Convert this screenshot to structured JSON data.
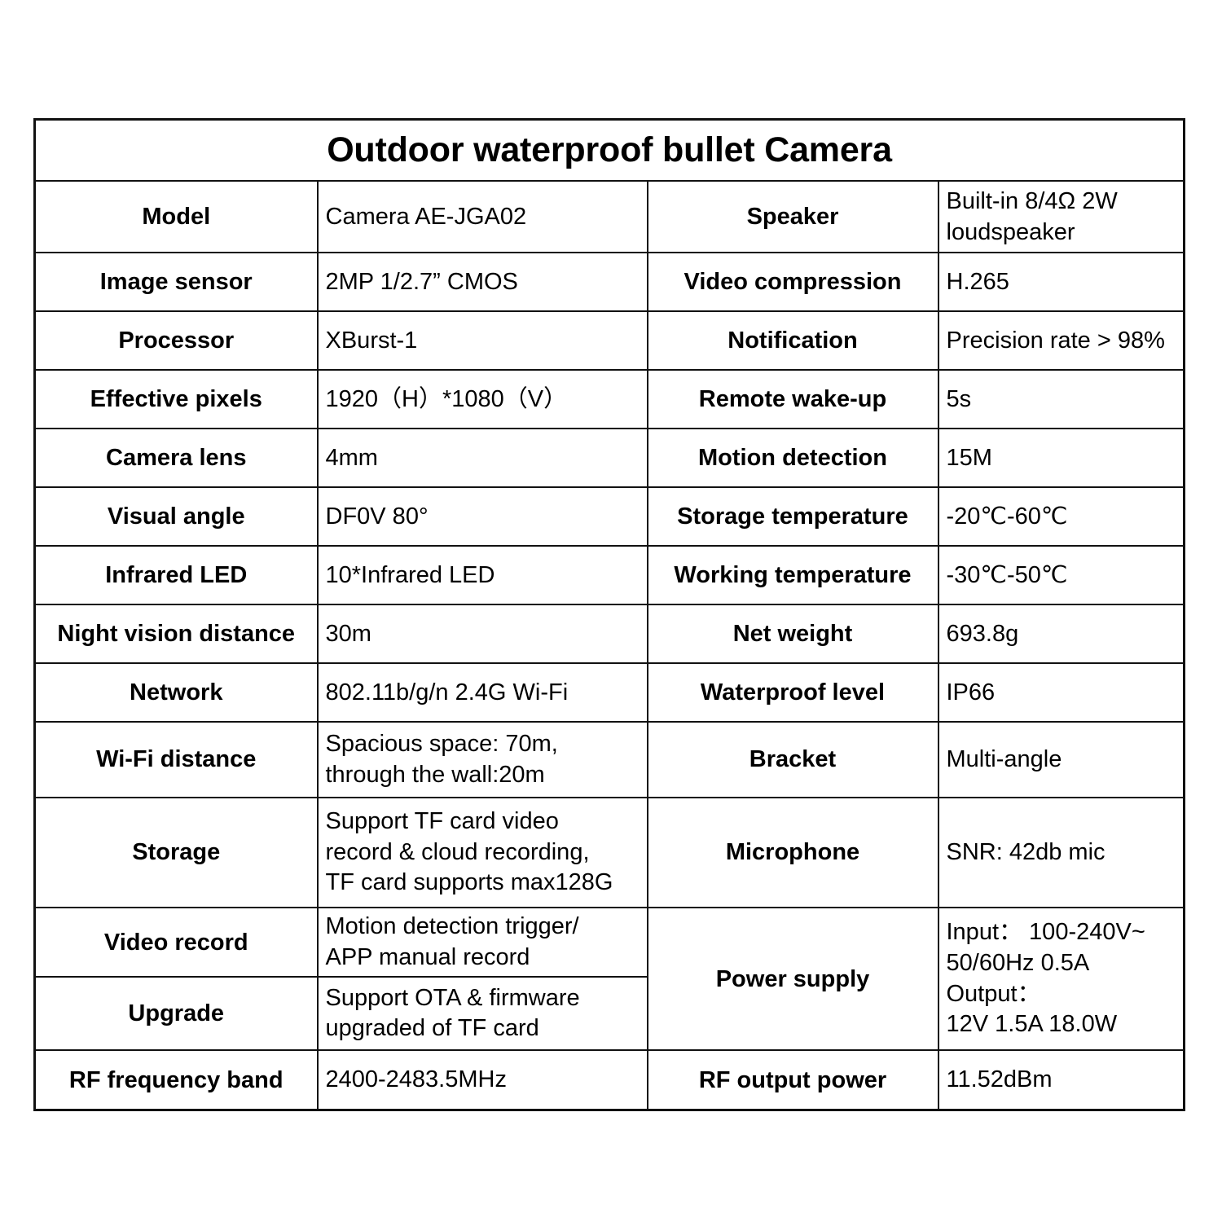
{
  "document": {
    "title": "Outdoor waterproof bullet Camera"
  },
  "rows": [
    {
      "left_label": "Model",
      "left_value": [
        "Camera AE-JGA02"
      ],
      "right_label": "Speaker",
      "right_value": [
        "Built-in 8/4Ω 2W",
        "loudspeaker"
      ]
    },
    {
      "left_label": "Image sensor",
      "left_value": [
        "2MP 1/2.7” CMOS"
      ],
      "right_label": "Video compression",
      "right_value": [
        "H.265"
      ]
    },
    {
      "left_label": "Processor",
      "left_value": [
        "XBurst-1"
      ],
      "right_label": "Notification",
      "right_value": [
        "Precision rate > 98%"
      ]
    },
    {
      "left_label": "Effective pixels",
      "left_value": [
        "1920（H）*1080（V）"
      ],
      "right_label": "Remote wake-up",
      "right_value": [
        "5s"
      ]
    },
    {
      "left_label": "Camera lens",
      "left_value": [
        "4mm"
      ],
      "right_label": "Motion detection",
      "right_value": [
        "15M"
      ]
    },
    {
      "left_label": "Visual angle",
      "left_value": [
        "DF0V 80°"
      ],
      "right_label": "Storage temperature",
      "right_value": [
        "-20℃-60℃"
      ]
    },
    {
      "left_label": "Infrared LED",
      "left_value": [
        "10*Infrared LED"
      ],
      "right_label": "Working temperature",
      "right_value": [
        "-30℃-50℃"
      ]
    },
    {
      "left_label": "Night vision distance",
      "left_value": [
        "30m"
      ],
      "right_label": "Net weight",
      "right_value": [
        "693.8g"
      ]
    },
    {
      "left_label": "Network",
      "left_value": [
        "802.11b/g/n 2.4G Wi-Fi"
      ],
      "right_label": "Waterproof level",
      "right_value": [
        "IP66"
      ]
    },
    {
      "left_label": "Wi-Fi distance",
      "left_value": [
        "Spacious space: 70m,",
        "through the wall:20m"
      ],
      "right_label": "Bracket",
      "right_value": [
        "Multi-angle"
      ]
    },
    {
      "left_label": "Storage",
      "left_value": [
        "Support TF card video",
        "record & cloud recording,",
        "TF card supports max128G"
      ],
      "right_label": "Microphone",
      "right_value": [
        "SNR: 42db mic"
      ]
    },
    {
      "left_label": "Video record",
      "left_value": [
        "Motion detection trigger/",
        "APP manual record"
      ],
      "right_label": "Power supply",
      "right_value": [
        "Input： 100-240V~",
        "50/60Hz 0.5A",
        "Output：",
        "12V 1.5A 18.0W"
      ]
    },
    {
      "left_label": "Upgrade",
      "left_value": [
        "Support OTA & firmware",
        "upgraded of TF card"
      ],
      "right_label": "",
      "right_value": []
    },
    {
      "left_label": "RF frequency band",
      "left_value": [
        "2400-2483.5MHz"
      ],
      "right_label": "RF output power",
      "right_value": [
        " 11.52dBm"
      ]
    }
  ]
}
